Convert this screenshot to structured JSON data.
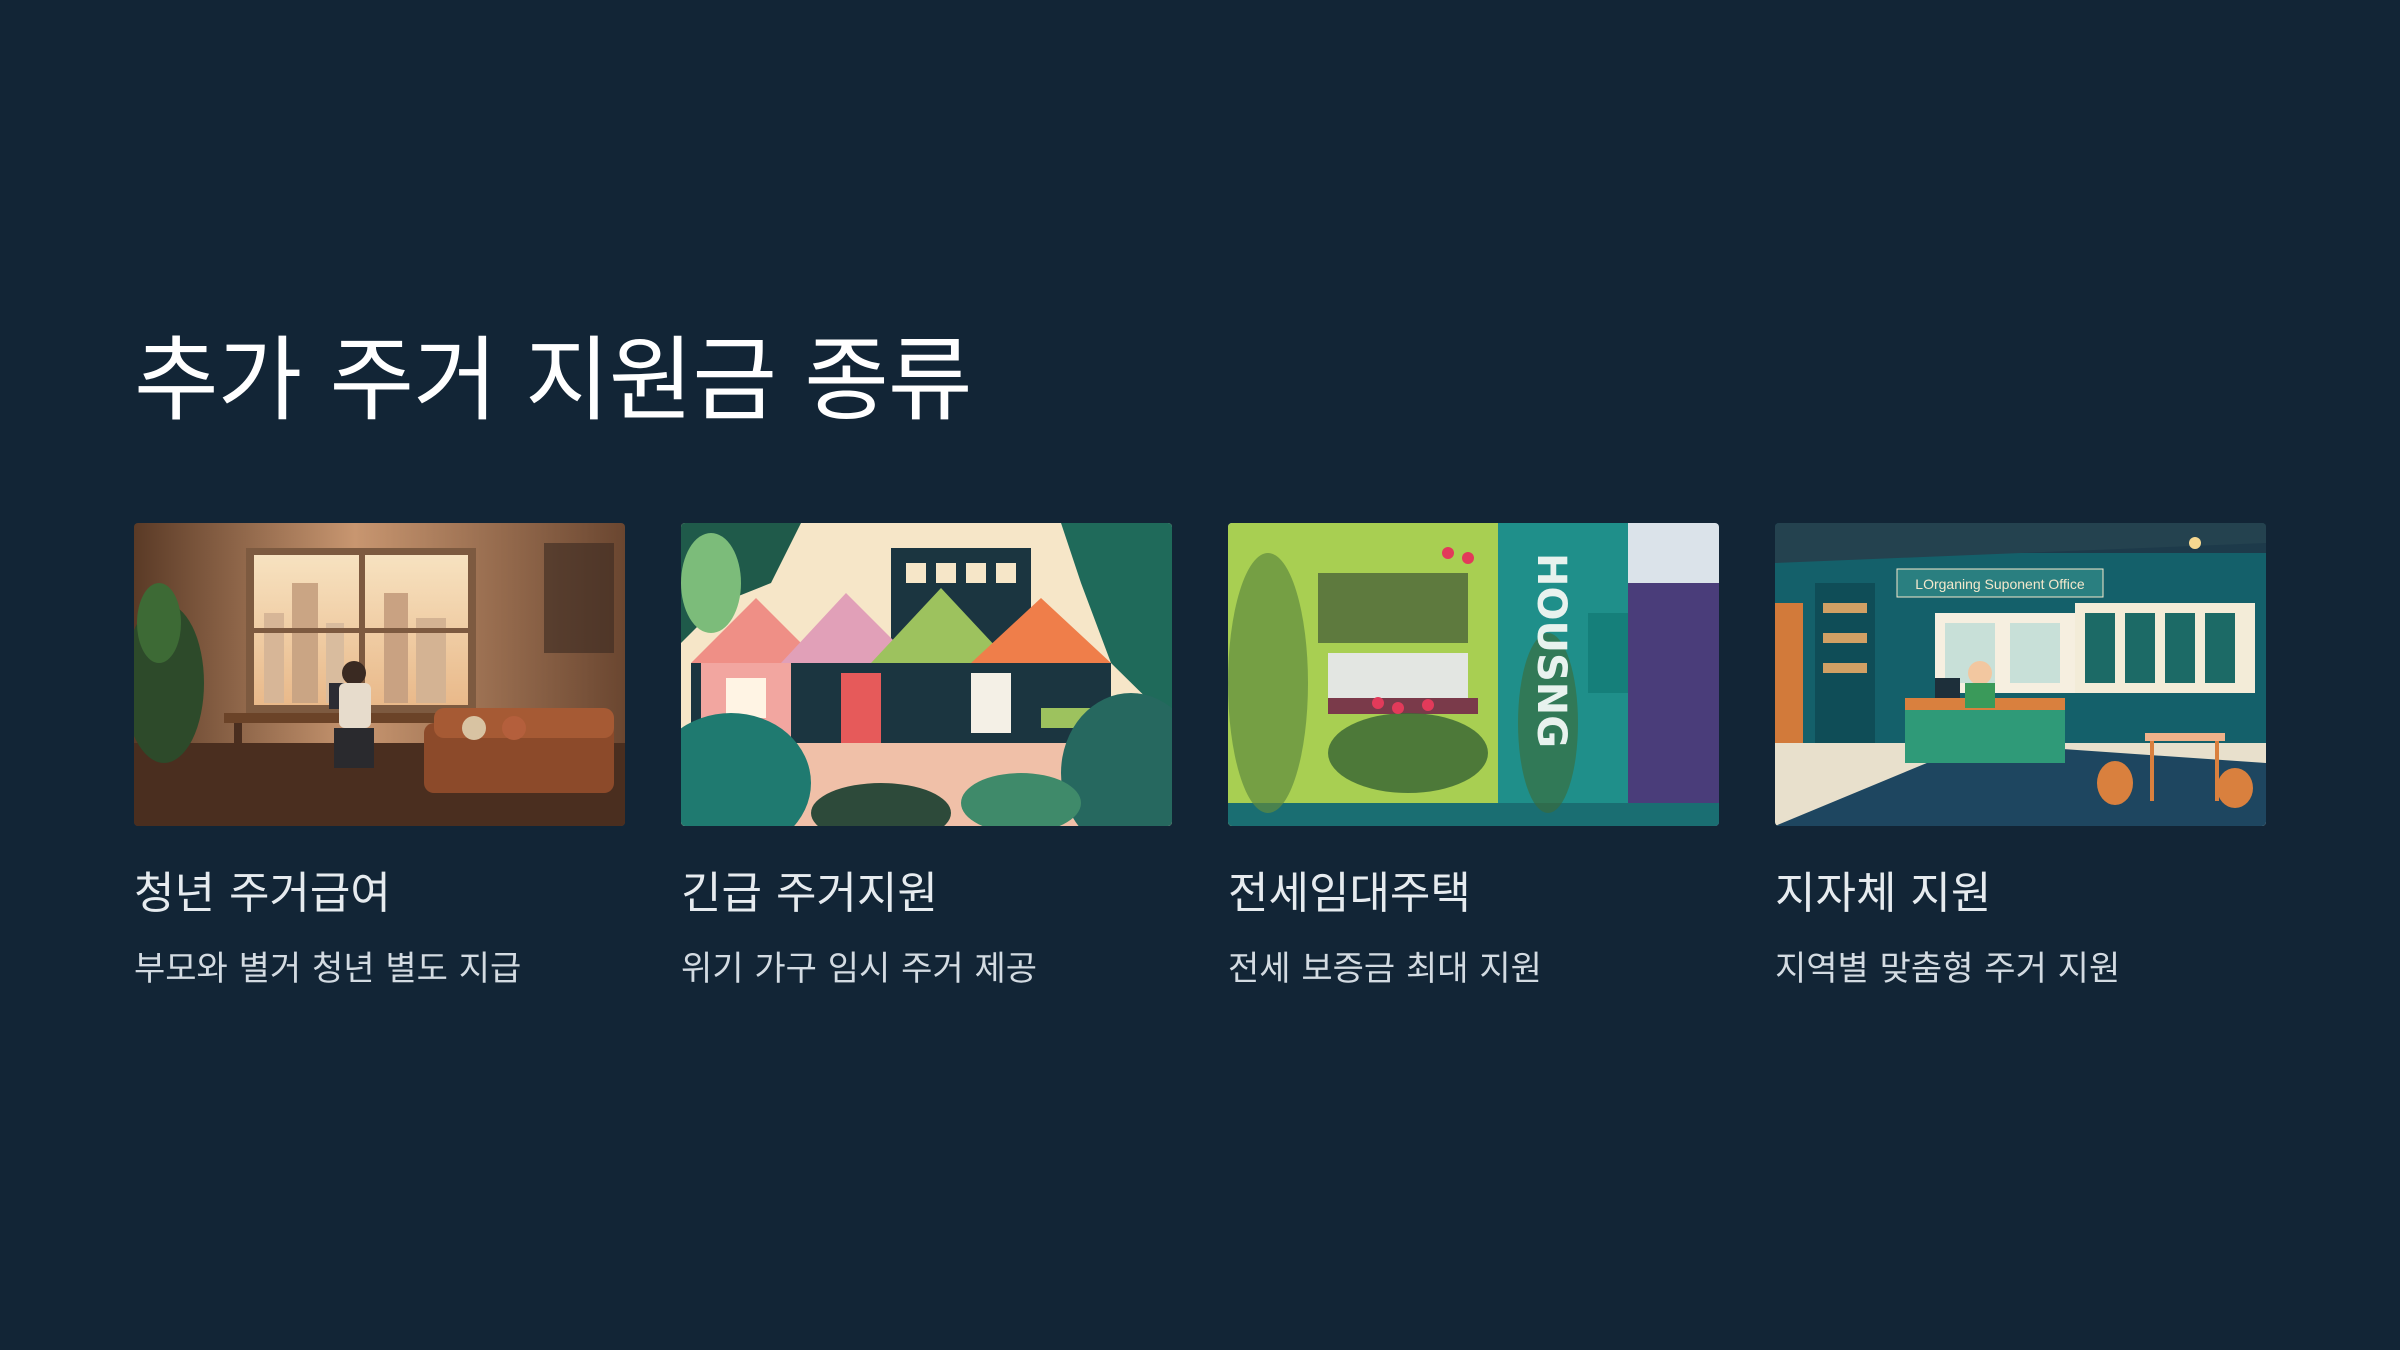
{
  "slide": {
    "title": "추가 주거 지원금 종류"
  },
  "cards": [
    {
      "image_icon": "room-illustration-icon",
      "title": "청년 주거급여",
      "description": "부모와 별거 청년 별도 지급"
    },
    {
      "image_icon": "tent-shelter-illustration-icon",
      "title": "긴급 주거지원",
      "description": "위기 가구 임시 주거 제공"
    },
    {
      "image_icon": "housing-building-illustration-icon",
      "title": "전세임대주택",
      "description": "전세 보증금 최대 지원",
      "image_sign": "HOUSNG"
    },
    {
      "image_icon": "office-illustration-icon",
      "title": "지자체 지원",
      "description": "지역별 맞춤형 주거 지원",
      "image_sign": "LOrganing Suponent Office"
    }
  ],
  "colors": {
    "background": "#122536",
    "title_text": "#ffffff",
    "card_title_text": "#e6ebef",
    "card_desc_text": "#d3dbe2"
  }
}
